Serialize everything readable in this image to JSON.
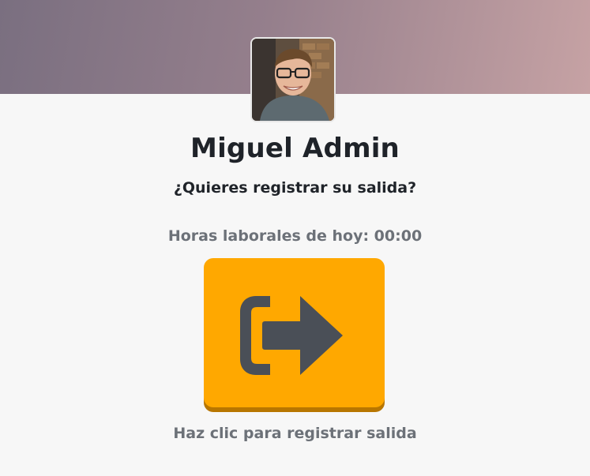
{
  "user": {
    "name": "Miguel Admin",
    "avatar_icon": "user-photo"
  },
  "prompt": {
    "question": "¿Quieres registrar su salida?",
    "hours_label": "Horas laborales de hoy: 00:00"
  },
  "action": {
    "icon": "sign-out-icon",
    "hint": "Haz clic para registrar salida"
  },
  "colors": {
    "header_gradient_start": "#7a6f80",
    "header_gradient_end": "#c6a2a4",
    "button": "#ffa800",
    "button_shadow": "#b87600",
    "icon": "#4a4f57",
    "text_dark": "#1f2329",
    "text_muted": "#6c7178"
  }
}
